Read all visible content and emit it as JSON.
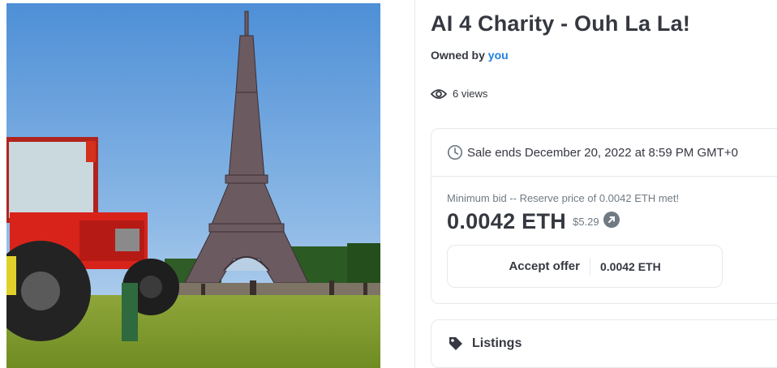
{
  "nft": {
    "title": "AI 4 Charity - Ouh La La!",
    "owner_prefix": "Owned by",
    "owner_link": "you",
    "views": "6 views"
  },
  "sale": {
    "ends_text": "Sale ends December 20, 2022 at 8:59 PM GMT+0",
    "min_bid_text": "Minimum bid -- Reserve price of 0.0042 ETH met!",
    "price": "0.0042 ETH",
    "price_usd": "$5.29",
    "accept_label": "Accept offer",
    "accept_value": "0.0042 ETH"
  },
  "listings": {
    "label": "Listings"
  },
  "icons": {
    "views": "eye-icon",
    "sale": "clock-icon",
    "usd": "arrow-up-right-icon",
    "listings": "tag-icon",
    "artwork": "tractor-eiffel-tower-artwork"
  },
  "colors": {
    "link": "#2081e2",
    "text": "#353840",
    "muted": "#707a83",
    "border": "#e5e8eb"
  }
}
